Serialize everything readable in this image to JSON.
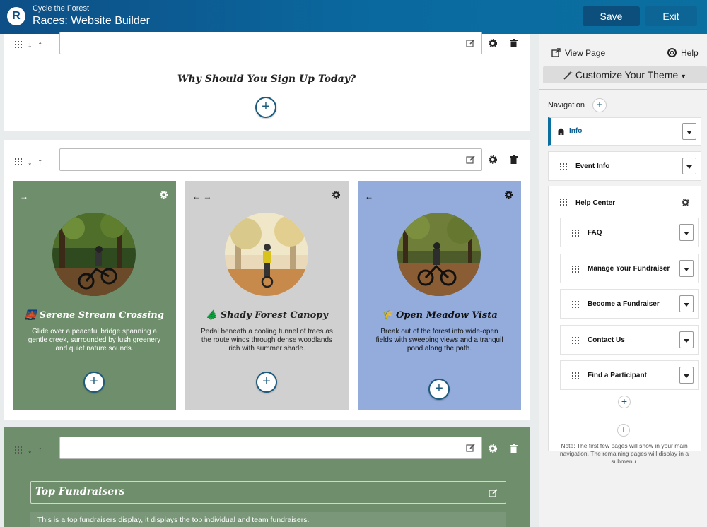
{
  "header": {
    "logo_letter": "R",
    "org_name": "Cycle the Forest",
    "app_title": "Races: Website Builder",
    "save_label": "Save",
    "exit_label": "Exit"
  },
  "canvas": {
    "section1": {
      "heading": "Why Should You Sign Up Today?"
    },
    "section2": {
      "cards": [
        {
          "nav": "→",
          "emoji": "🌉",
          "title": "Serene Stream Crossing",
          "description": "Glide over a peaceful bridge spanning a gentle creek, surrounded by lush greenery and quiet nature sounds."
        },
        {
          "nav": "← →",
          "emoji": "🌲",
          "title": "Shady Forest Canopy",
          "description": "Pedal beneath a cooling tunnel of trees as the route winds through dense woodlands rich with summer shade."
        },
        {
          "nav": "←",
          "emoji": "🌾",
          "title": "Open Meadow Vista",
          "description": "Break out of the forest into wide-open fields with sweeping views and a tranquil pond along the path."
        }
      ]
    },
    "section3": {
      "title": "Top Fundraisers",
      "description": "This is a top fundraisers display, it displays the top individual and team fundraisers."
    }
  },
  "sidebar": {
    "view_page_label": "View Page",
    "help_label": "Help",
    "theme_button_label": "Customize Your Theme",
    "navigation_label": "Navigation",
    "items": [
      {
        "label": "Info"
      },
      {
        "label": "Event Info"
      },
      {
        "label": "Help Center",
        "children": [
          {
            "label": "FAQ"
          },
          {
            "label": "Manage Your Fundraiser"
          },
          {
            "label": "Become a Fundraiser"
          },
          {
            "label": "Contact Us"
          },
          {
            "label": "Find a Participant"
          }
        ]
      }
    ],
    "note": "Note: The first few pages will show in your main navigation. The remaining pages will display in a submenu."
  },
  "colors": {
    "header_start": "#0d4f86",
    "header_end": "#0b6fa0",
    "card1_bg": "#6f8f6c",
    "card2_bg": "#d0d0d0",
    "card3_bg": "#93acdc",
    "accent": "#1c5a7e"
  },
  "icons": [
    "drag-handle-icon",
    "arrow-down-icon",
    "arrow-up-icon",
    "edit-icon",
    "gear-icon",
    "trash-icon",
    "plus-icon",
    "external-link-icon",
    "lifebuoy-icon",
    "magic-wand-icon",
    "home-icon",
    "chevron-down-icon"
  ]
}
